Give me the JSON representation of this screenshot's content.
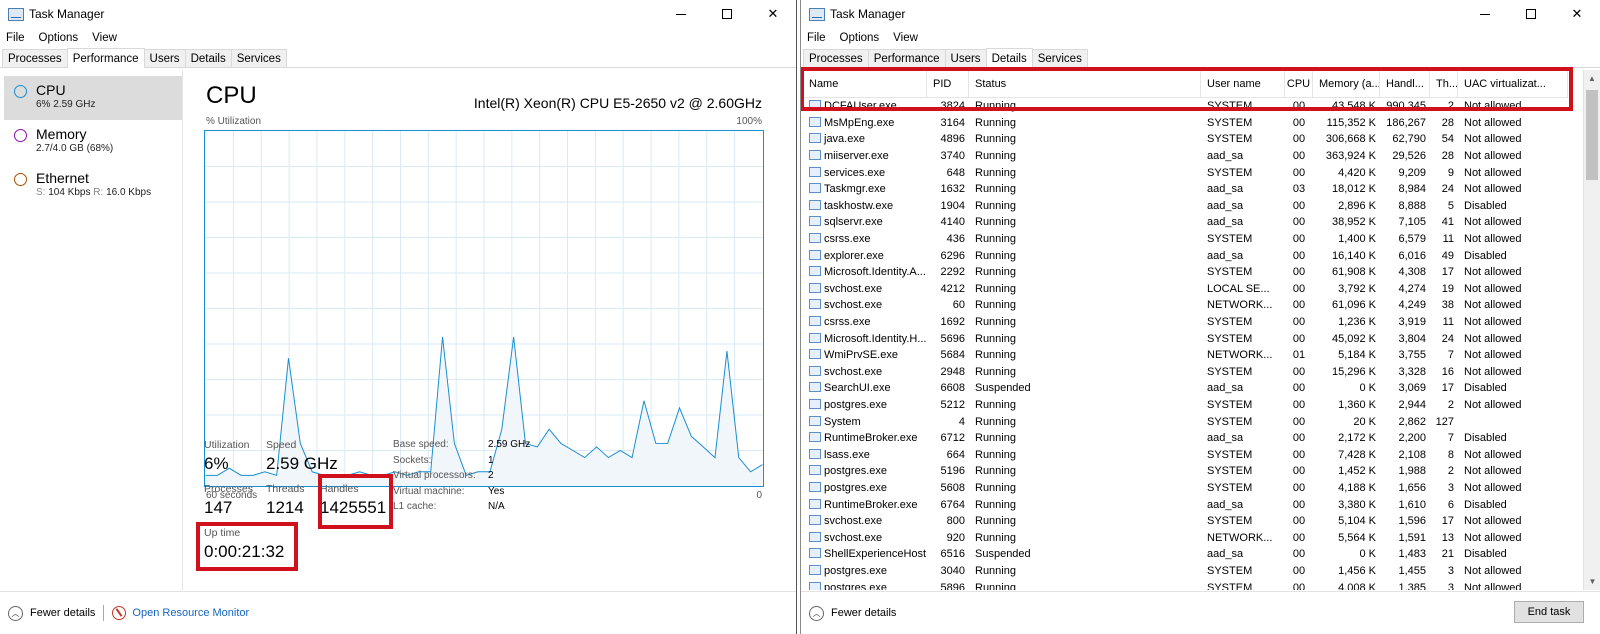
{
  "window1": {
    "title": "Task Manager",
    "menu": [
      "File",
      "Options",
      "View"
    ],
    "tabs": [
      "Processes",
      "Performance",
      "Users",
      "Details",
      "Services"
    ],
    "sidebar": [
      {
        "name": "CPU",
        "sub": "6% 2.59 GHz",
        "color": "#1a8ed3"
      },
      {
        "name": "Memory",
        "sub": "2.7/4.0 GB (68%)",
        "color": "#8b12ae"
      },
      {
        "name": "Ethernet",
        "send_label": "S:",
        "send": "104 Kbps",
        "recv_label": "R:",
        "recv": "16.0 Kbps",
        "color": "#a74f01"
      }
    ],
    "cpu_title": "CPU",
    "cpu_model": "Intel(R) Xeon(R) CPU E5-2650 v2 @ 2.60GHz",
    "util_label": "% Utilization",
    "util_max": "100%",
    "time_label": "60 seconds",
    "time_zero": "0",
    "stats": {
      "utilization_label": "Utilization",
      "utilization": "6%",
      "speed_label": "Speed",
      "speed": "2.59 GHz",
      "processes_label": "Processes",
      "processes": "147",
      "threads_label": "Threads",
      "threads": "1214",
      "handles_label": "Handles",
      "handles": "1425551",
      "uptime_label": "Up time",
      "uptime": "0:00:21:32"
    },
    "specs": [
      {
        "k": "Base speed:",
        "v": "2.59 GHz"
      },
      {
        "k": "Sockets:",
        "v": "1"
      },
      {
        "k": "Virtual processors:",
        "v": "2"
      },
      {
        "k": "Virtual machine:",
        "v": "Yes"
      },
      {
        "k": "L1 cache:",
        "v": "N/A"
      }
    ],
    "fewer_details": "Fewer details",
    "resource_monitor": "Open Resource Monitor"
  },
  "window2": {
    "title": "Task Manager",
    "menu": [
      "File",
      "Options",
      "View"
    ],
    "tabs": [
      "Processes",
      "Performance",
      "Users",
      "Details",
      "Services"
    ],
    "columns": [
      "Name",
      "PID",
      "Status",
      "User name",
      "CPU",
      "Memory (a...",
      "Handl...",
      "Th...",
      "UAC virtualizat..."
    ],
    "rows": [
      [
        "DCFAUser.exe",
        "3824",
        "Running",
        "SYSTEM",
        "00",
        "43,548 K",
        "990,345",
        "2",
        "Not allowed"
      ],
      [
        "MsMpEng.exe",
        "3164",
        "Running",
        "SYSTEM",
        "00",
        "115,352 K",
        "186,267",
        "28",
        "Not allowed"
      ],
      [
        "java.exe",
        "4896",
        "Running",
        "SYSTEM",
        "00",
        "306,668 K",
        "62,790",
        "54",
        "Not allowed"
      ],
      [
        "miiserver.exe",
        "3740",
        "Running",
        "aad_sa",
        "00",
        "363,924 K",
        "29,526",
        "28",
        "Not allowed"
      ],
      [
        "services.exe",
        "648",
        "Running",
        "SYSTEM",
        "00",
        "4,420 K",
        "9,209",
        "9",
        "Not allowed"
      ],
      [
        "Taskmgr.exe",
        "1632",
        "Running",
        "aad_sa",
        "03",
        "18,012 K",
        "8,984",
        "24",
        "Not allowed"
      ],
      [
        "taskhostw.exe",
        "1904",
        "Running",
        "aad_sa",
        "00",
        "2,896 K",
        "8,888",
        "5",
        "Disabled"
      ],
      [
        "sqlservr.exe",
        "4140",
        "Running",
        "aad_sa",
        "00",
        "38,952 K",
        "7,105",
        "41",
        "Not allowed"
      ],
      [
        "csrss.exe",
        "436",
        "Running",
        "SYSTEM",
        "00",
        "1,400 K",
        "6,579",
        "11",
        "Not allowed"
      ],
      [
        "explorer.exe",
        "6296",
        "Running",
        "aad_sa",
        "00",
        "16,140 K",
        "6,016",
        "49",
        "Disabled"
      ],
      [
        "Microsoft.Identity.A...",
        "2292",
        "Running",
        "SYSTEM",
        "00",
        "61,908 K",
        "4,308",
        "17",
        "Not allowed"
      ],
      [
        "svchost.exe",
        "4212",
        "Running",
        "LOCAL SE...",
        "00",
        "3,792 K",
        "4,274",
        "19",
        "Not allowed"
      ],
      [
        "svchost.exe",
        "60",
        "Running",
        "NETWORK...",
        "00",
        "61,096 K",
        "4,249",
        "38",
        "Not allowed"
      ],
      [
        "csrss.exe",
        "1692",
        "Running",
        "SYSTEM",
        "00",
        "1,236 K",
        "3,919",
        "11",
        "Not allowed"
      ],
      [
        "Microsoft.Identity.H...",
        "5696",
        "Running",
        "SYSTEM",
        "00",
        "45,092 K",
        "3,804",
        "24",
        "Not allowed"
      ],
      [
        "WmiPrvSE.exe",
        "5684",
        "Running",
        "NETWORK...",
        "01",
        "5,184 K",
        "3,755",
        "7",
        "Not allowed"
      ],
      [
        "svchost.exe",
        "2948",
        "Running",
        "SYSTEM",
        "00",
        "15,296 K",
        "3,328",
        "16",
        "Not allowed"
      ],
      [
        "SearchUI.exe",
        "6608",
        "Suspended",
        "aad_sa",
        "00",
        "0 K",
        "3,069",
        "17",
        "Disabled"
      ],
      [
        "postgres.exe",
        "5212",
        "Running",
        "SYSTEM",
        "00",
        "1,360 K",
        "2,944",
        "2",
        "Not allowed"
      ],
      [
        "System",
        "4",
        "Running",
        "SYSTEM",
        "00",
        "20 K",
        "2,862",
        "127",
        ""
      ],
      [
        "RuntimeBroker.exe",
        "6712",
        "Running",
        "aad_sa",
        "00",
        "2,172 K",
        "2,200",
        "7",
        "Disabled"
      ],
      [
        "lsass.exe",
        "664",
        "Running",
        "SYSTEM",
        "00",
        "7,428 K",
        "2,108",
        "8",
        "Not allowed"
      ],
      [
        "postgres.exe",
        "5196",
        "Running",
        "SYSTEM",
        "00",
        "1,452 K",
        "1,988",
        "2",
        "Not allowed"
      ],
      [
        "postgres.exe",
        "5608",
        "Running",
        "SYSTEM",
        "00",
        "4,188 K",
        "1,656",
        "3",
        "Not allowed"
      ],
      [
        "RuntimeBroker.exe",
        "6764",
        "Running",
        "aad_sa",
        "00",
        "3,380 K",
        "1,610",
        "6",
        "Disabled"
      ],
      [
        "svchost.exe",
        "800",
        "Running",
        "SYSTEM",
        "00",
        "5,104 K",
        "1,596",
        "17",
        "Not allowed"
      ],
      [
        "svchost.exe",
        "920",
        "Running",
        "NETWORK...",
        "00",
        "5,564 K",
        "1,591",
        "13",
        "Not allowed"
      ],
      [
        "ShellExperienceHost....",
        "6516",
        "Suspended",
        "aad_sa",
        "00",
        "0 K",
        "1,483",
        "21",
        "Disabled"
      ],
      [
        "postgres.exe",
        "3040",
        "Running",
        "SYSTEM",
        "00",
        "1,456 K",
        "1,455",
        "3",
        "Not allowed"
      ],
      [
        "postgres.exe",
        "5896",
        "Running",
        "SYSTEM",
        "00",
        "4,008 K",
        "1,385",
        "3",
        "Not allowed"
      ]
    ],
    "fewer_details": "Fewer details",
    "end_task": "End task"
  },
  "colors": {
    "accent": "#1a8ed3",
    "highlight_box": "#d0101c",
    "graph_fill": "#f1f6fb"
  },
  "cpu_series": [
    3,
    3,
    5,
    3,
    3,
    4,
    3,
    36,
    12,
    4,
    3,
    3,
    3,
    4,
    3,
    3,
    4,
    3,
    4,
    4,
    42,
    12,
    3,
    4,
    4,
    16,
    42,
    12,
    11,
    16,
    12,
    10,
    8,
    11,
    8,
    10,
    8,
    24,
    12,
    12,
    22,
    14,
    11,
    8,
    38,
    8,
    4,
    6
  ]
}
